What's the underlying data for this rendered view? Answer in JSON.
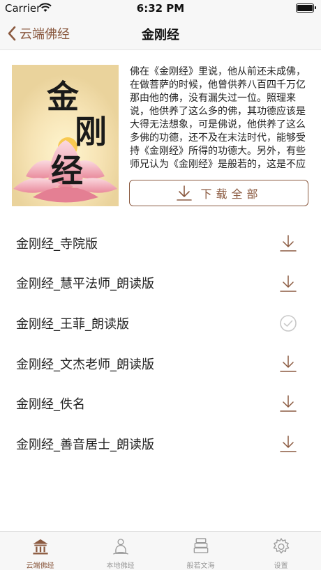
{
  "status_bar": {
    "carrier": "Carrier",
    "time": "6:32 PM"
  },
  "nav": {
    "back_label": "云端佛经",
    "title": "金刚经"
  },
  "book": {
    "cover_title": "金刚经",
    "description": "佛在《金刚经》里说，他从前还未成佛，在做菩萨的时候，他曾供养八百四千万亿那由他的佛，没有漏失过一位。照理来说，他供养了这么多的佛，其功德应该是大得无法想象，可是佛说，他供养了这么多佛的功德，还不及在末法时代，能够受持《金刚经》所得的功德大。另外，有些师兄认为《金刚经》是般若的，这是不应",
    "download_all_label": "下载全部"
  },
  "tracks": [
    {
      "title": "金刚经_寺院版",
      "status": "download"
    },
    {
      "title": "金刚经_慧平法师_朗读版",
      "status": "download"
    },
    {
      "title": "金刚经_王菲_朗读版",
      "status": "downloaded"
    },
    {
      "title": "金刚经_文杰老师_朗读版",
      "status": "download"
    },
    {
      "title": "金刚经_佚名",
      "status": "download"
    },
    {
      "title": "金刚经_善音居士_朗读版",
      "status": "download"
    }
  ],
  "tabs": [
    {
      "label": "云端佛经",
      "icon": "temple-icon",
      "active": true
    },
    {
      "label": "本地佛经",
      "icon": "buddha-icon",
      "active": false
    },
    {
      "label": "般若文海",
      "icon": "books-icon",
      "active": false
    },
    {
      "label": "设置",
      "icon": "gear-icon",
      "active": false
    }
  ],
  "colors": {
    "accent": "#8b5a40",
    "inactive": "#9a9a9a",
    "downloaded": "#c8c8c8"
  }
}
